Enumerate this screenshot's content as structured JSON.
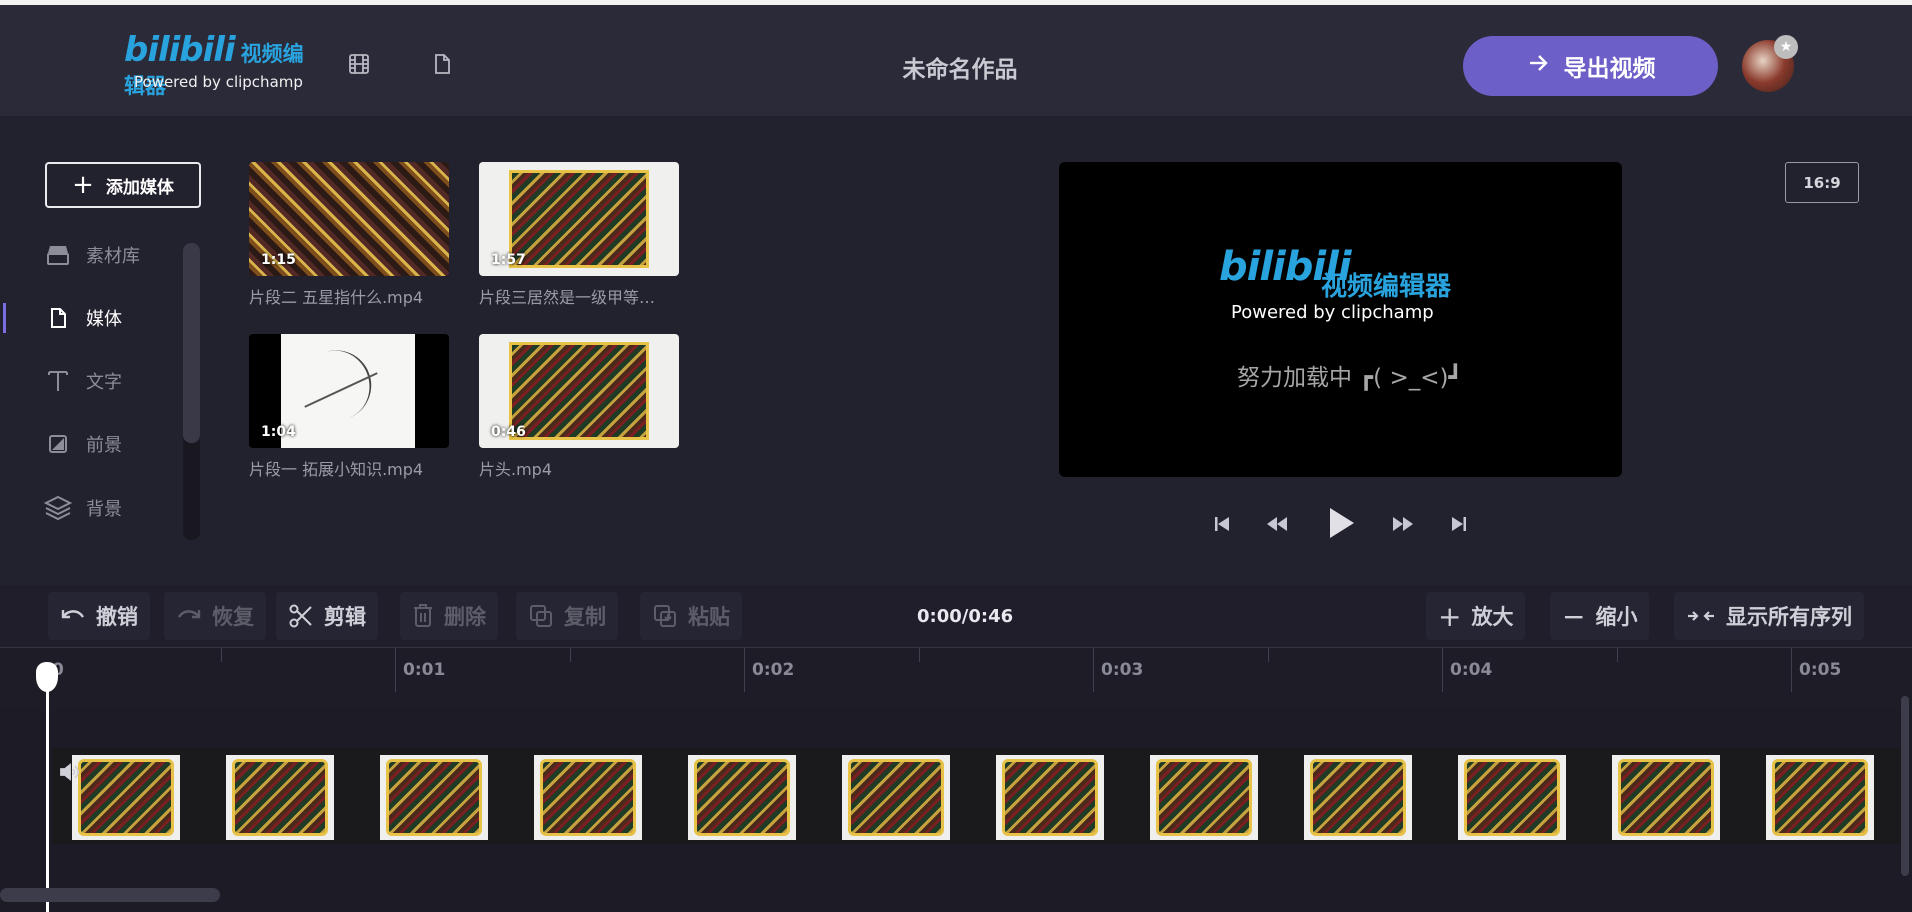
{
  "header": {
    "logo_brand": "bilibili",
    "logo_sub": "视频编辑器",
    "powered_by": "Powered by clipchamp",
    "project_title": "未命名作品",
    "export_label": "导出视频"
  },
  "sidebar": {
    "add_media_label": "添加媒体",
    "items": [
      {
        "label": "素材库",
        "icon": "library-icon"
      },
      {
        "label": "媒体",
        "icon": "file-icon"
      },
      {
        "label": "文字",
        "icon": "text-icon"
      },
      {
        "label": "前景",
        "icon": "foreground-icon"
      },
      {
        "label": "背景",
        "icon": "layers-icon"
      }
    ]
  },
  "media": [
    {
      "name": "片段二 五星指什么.mp4",
      "duration": "1:15"
    },
    {
      "name": "片段三居然是一级甲等…",
      "duration": "1:57"
    },
    {
      "name": "片段一 拓展小知识.mp4",
      "duration": "1:04"
    },
    {
      "name": "片头.mp4",
      "duration": "0:46"
    }
  ],
  "preview": {
    "brand": "bilibili",
    "brand_sub": "视频编辑器",
    "powered_by": "Powered by clipchamp",
    "loading_text": "努力加载中 ┏( >_<)┛",
    "aspect_ratio": "16:9"
  },
  "toolbar": {
    "undo": "撤销",
    "redo": "恢复",
    "cut": "剪辑",
    "delete": "删除",
    "copy": "复制",
    "paste": "粘贴",
    "timecode": "0:00/0:46",
    "zoom_in": "放大",
    "zoom_out": "缩小",
    "fit": "显示所有序列"
  },
  "ruler": {
    "labels": [
      "0",
      "0:01",
      "0:02",
      "0:03",
      "0:04",
      "0:05"
    ]
  },
  "colors": {
    "accent": "#6c5fc7",
    "brand_blue": "#29a3dd",
    "background": "#22212e",
    "header": "#2b2a38"
  }
}
